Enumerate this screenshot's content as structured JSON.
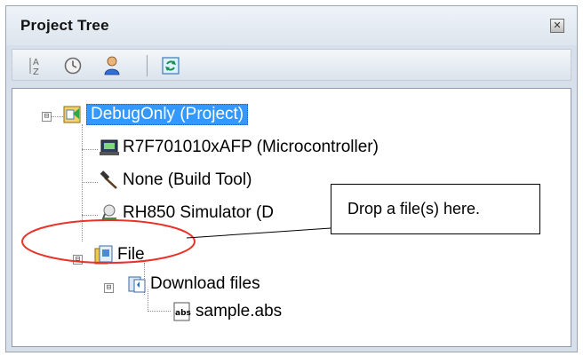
{
  "panel": {
    "title": "Project Tree",
    "close_icon": "close-icon"
  },
  "toolbar": {
    "buttons": [
      {
        "name": "sort-icon"
      },
      {
        "name": "history-icon"
      },
      {
        "name": "person-icon"
      },
      {
        "name": "refresh-icon"
      }
    ]
  },
  "tree": {
    "project": {
      "label": "DebugOnly (Project)",
      "icon": "project-icon",
      "expander": "⊟"
    },
    "microcontroller": {
      "label": "R7F701010xAFP (Microcontroller)",
      "icon": "microcontroller-icon"
    },
    "build_tool": {
      "label": "None (Build Tool)",
      "icon": "hammer-icon"
    },
    "debug_tool": {
      "label": "RH850 Simulator (D",
      "icon": "debug-tool-icon"
    },
    "file": {
      "label": "File",
      "icon": "folder-icon",
      "expander": "⊟"
    },
    "download_files": {
      "label": "Download files",
      "icon": "download-files-icon",
      "expander": "⊟"
    },
    "sample": {
      "label": "sample.abs",
      "icon": "abs-file-icon"
    }
  },
  "callout": {
    "text": "Drop a file(s) here."
  },
  "colors": {
    "selection": "#3399ff",
    "annotation_red": "#e8322a"
  }
}
